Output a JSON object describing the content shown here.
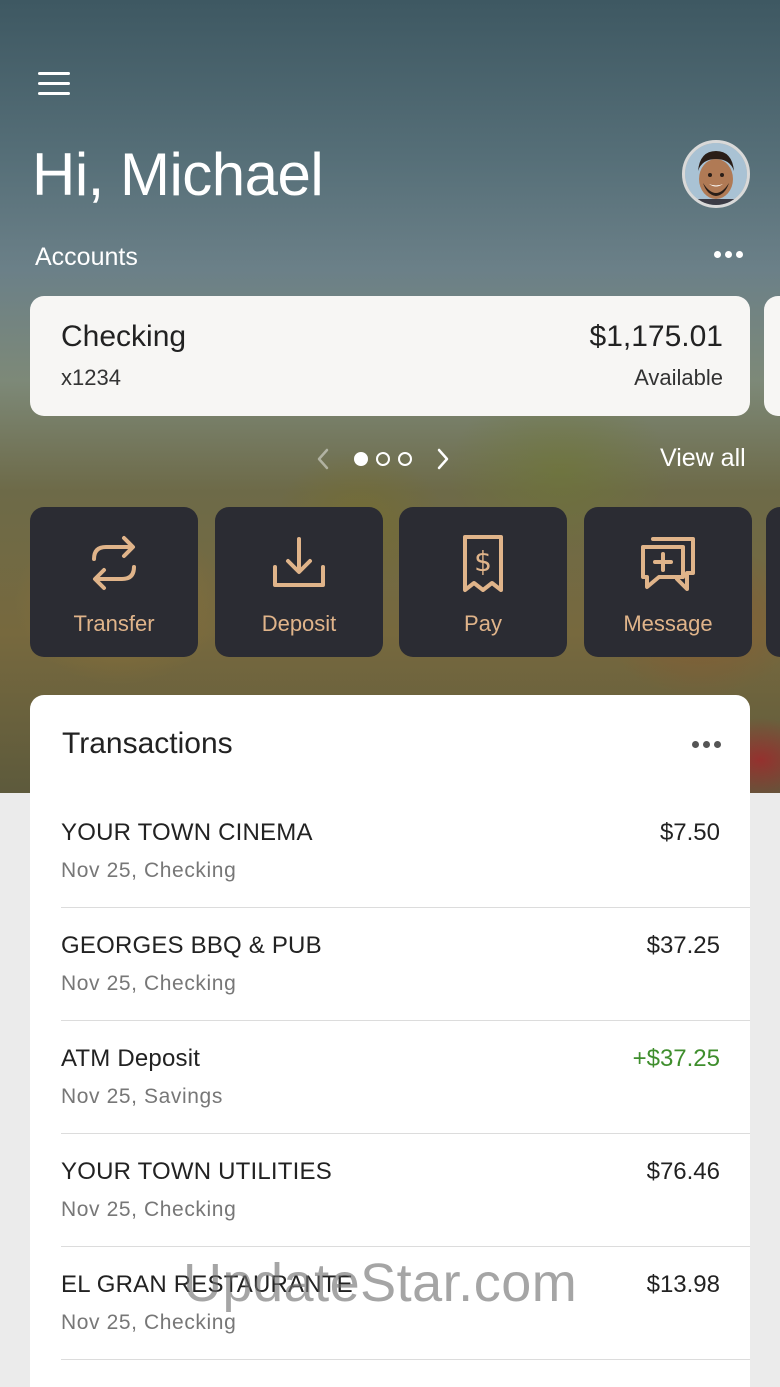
{
  "header": {
    "greeting": "Hi, Michael",
    "accounts_label": "Accounts"
  },
  "account": {
    "name": "Checking",
    "number": "x1234",
    "balance": "$1,175.01",
    "balance_label": "Available"
  },
  "pager": {
    "pages": 3,
    "active_page": 1,
    "view_all": "View all"
  },
  "actions": [
    {
      "label": "Transfer",
      "icon": "transfer-icon"
    },
    {
      "label": "Deposit",
      "icon": "deposit-icon"
    },
    {
      "label": "Pay",
      "icon": "pay-bill-icon"
    },
    {
      "label": "Message",
      "icon": "message-icon"
    }
  ],
  "transactions": {
    "title": "Transactions",
    "items": [
      {
        "name": "YOUR TOWN CINEMA",
        "detail": "Nov 25, Checking",
        "amount": "$7.50"
      },
      {
        "name": "GEORGES BBQ & PUB",
        "detail": "Nov 25, Checking",
        "amount": "$37.25"
      },
      {
        "name": "ATM Deposit",
        "detail": "Nov 25, Savings",
        "amount": "+$37.25"
      },
      {
        "name": "YOUR TOWN UTILITIES",
        "detail": "Nov 25, Checking",
        "amount": "$76.46"
      },
      {
        "name": "EL GRAN RESTAURANTE",
        "detail": "Nov 25, Checking",
        "amount": "$13.98"
      }
    ]
  },
  "watermark": "UpdateStar.com",
  "colors": {
    "accent": "#e0b48a",
    "action_tile": "#2b2c33",
    "positive_amount": "#3f8e2d"
  }
}
